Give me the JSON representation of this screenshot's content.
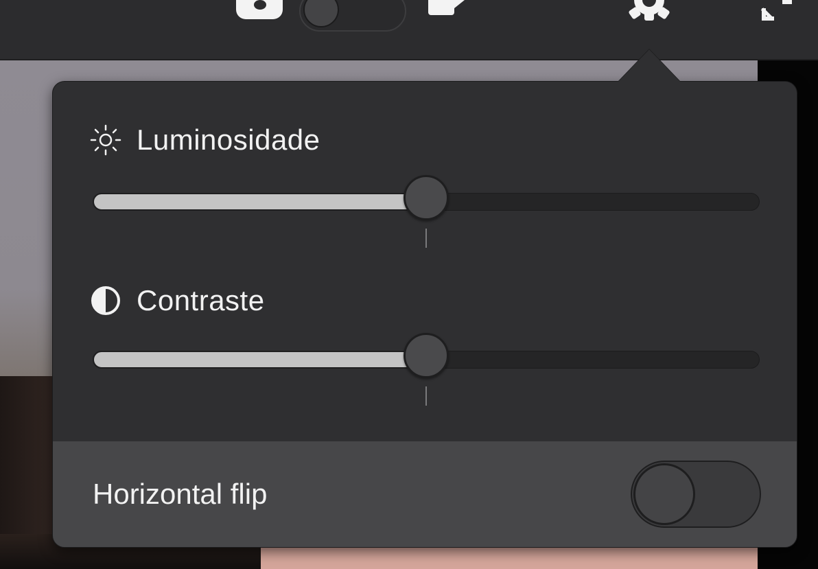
{
  "toolbar": {
    "camera_icon": "camera-icon",
    "toggle_state": "off",
    "mid_icon": "video-icon",
    "settings_icon": "gear-icon",
    "expand_icon": "expand-icon"
  },
  "settings": {
    "brightness": {
      "label": "Luminosidade",
      "icon": "sun-icon",
      "value_fraction": 0.5
    },
    "contrast": {
      "label": "Contraste",
      "icon": "contrast-icon",
      "value_fraction": 0.5
    },
    "flip": {
      "label": "Horizontal flip",
      "enabled": false
    }
  },
  "colors": {
    "panel_bg": "#2f2f31",
    "flip_row_bg": "#474749",
    "slider_fill": "#c4c4c4",
    "text": "#f2f2f2"
  }
}
